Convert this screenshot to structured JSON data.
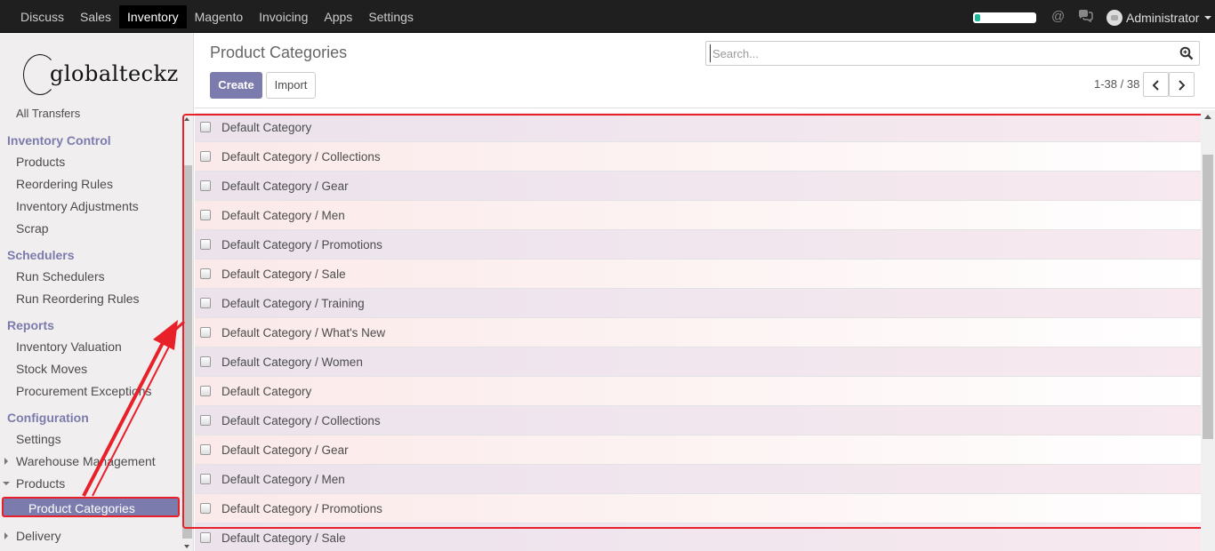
{
  "topbar": {
    "apps": [
      "Discuss",
      "Sales",
      "Inventory",
      "Magento",
      "Invoicing",
      "Apps",
      "Settings"
    ],
    "active_app": "Inventory",
    "user": "Administrator"
  },
  "logo": {
    "text": "globalteckz"
  },
  "sidebar": {
    "cut_item": "All Transfers",
    "sections": [
      {
        "title": "Inventory Control",
        "items": [
          "Products",
          "Reordering Rules",
          "Inventory Adjustments",
          "Scrap"
        ]
      },
      {
        "title": "Schedulers",
        "items": [
          "Run Schedulers",
          "Run Reordering Rules"
        ]
      },
      {
        "title": "Reports",
        "items": [
          "Inventory Valuation",
          "Stock Moves",
          "Procurement Exceptions"
        ]
      },
      {
        "title": "Configuration",
        "items": [
          "Settings",
          "Warehouse Management",
          "Products",
          "Product Categories",
          "Delivery"
        ]
      }
    ],
    "active_item": "Product Categories"
  },
  "control_panel": {
    "title": "Product Categories",
    "create_label": "Create",
    "import_label": "Import",
    "search_placeholder": "Search...",
    "pager": "1-38 / 38"
  },
  "list": {
    "rows": [
      "Default Category",
      "Default Category / Collections",
      "Default Category / Gear",
      "Default Category / Men",
      "Default Category / Promotions",
      "Default Category / Sale",
      "Default Category / Training",
      "Default Category / What's New",
      "Default Category / Women",
      "Default Category",
      "Default Category / Collections",
      "Default Category / Gear",
      "Default Category / Men",
      "Default Category / Promotions",
      "Default Category / Sale"
    ]
  },
  "colors": {
    "accent": "#7c7bad",
    "highlight": "#e8202a",
    "topbar": "#1f1f1f"
  },
  "icons": {
    "search": "magnifier-icon",
    "mention": "at-icon",
    "chat": "chat-bubbles-icon"
  }
}
